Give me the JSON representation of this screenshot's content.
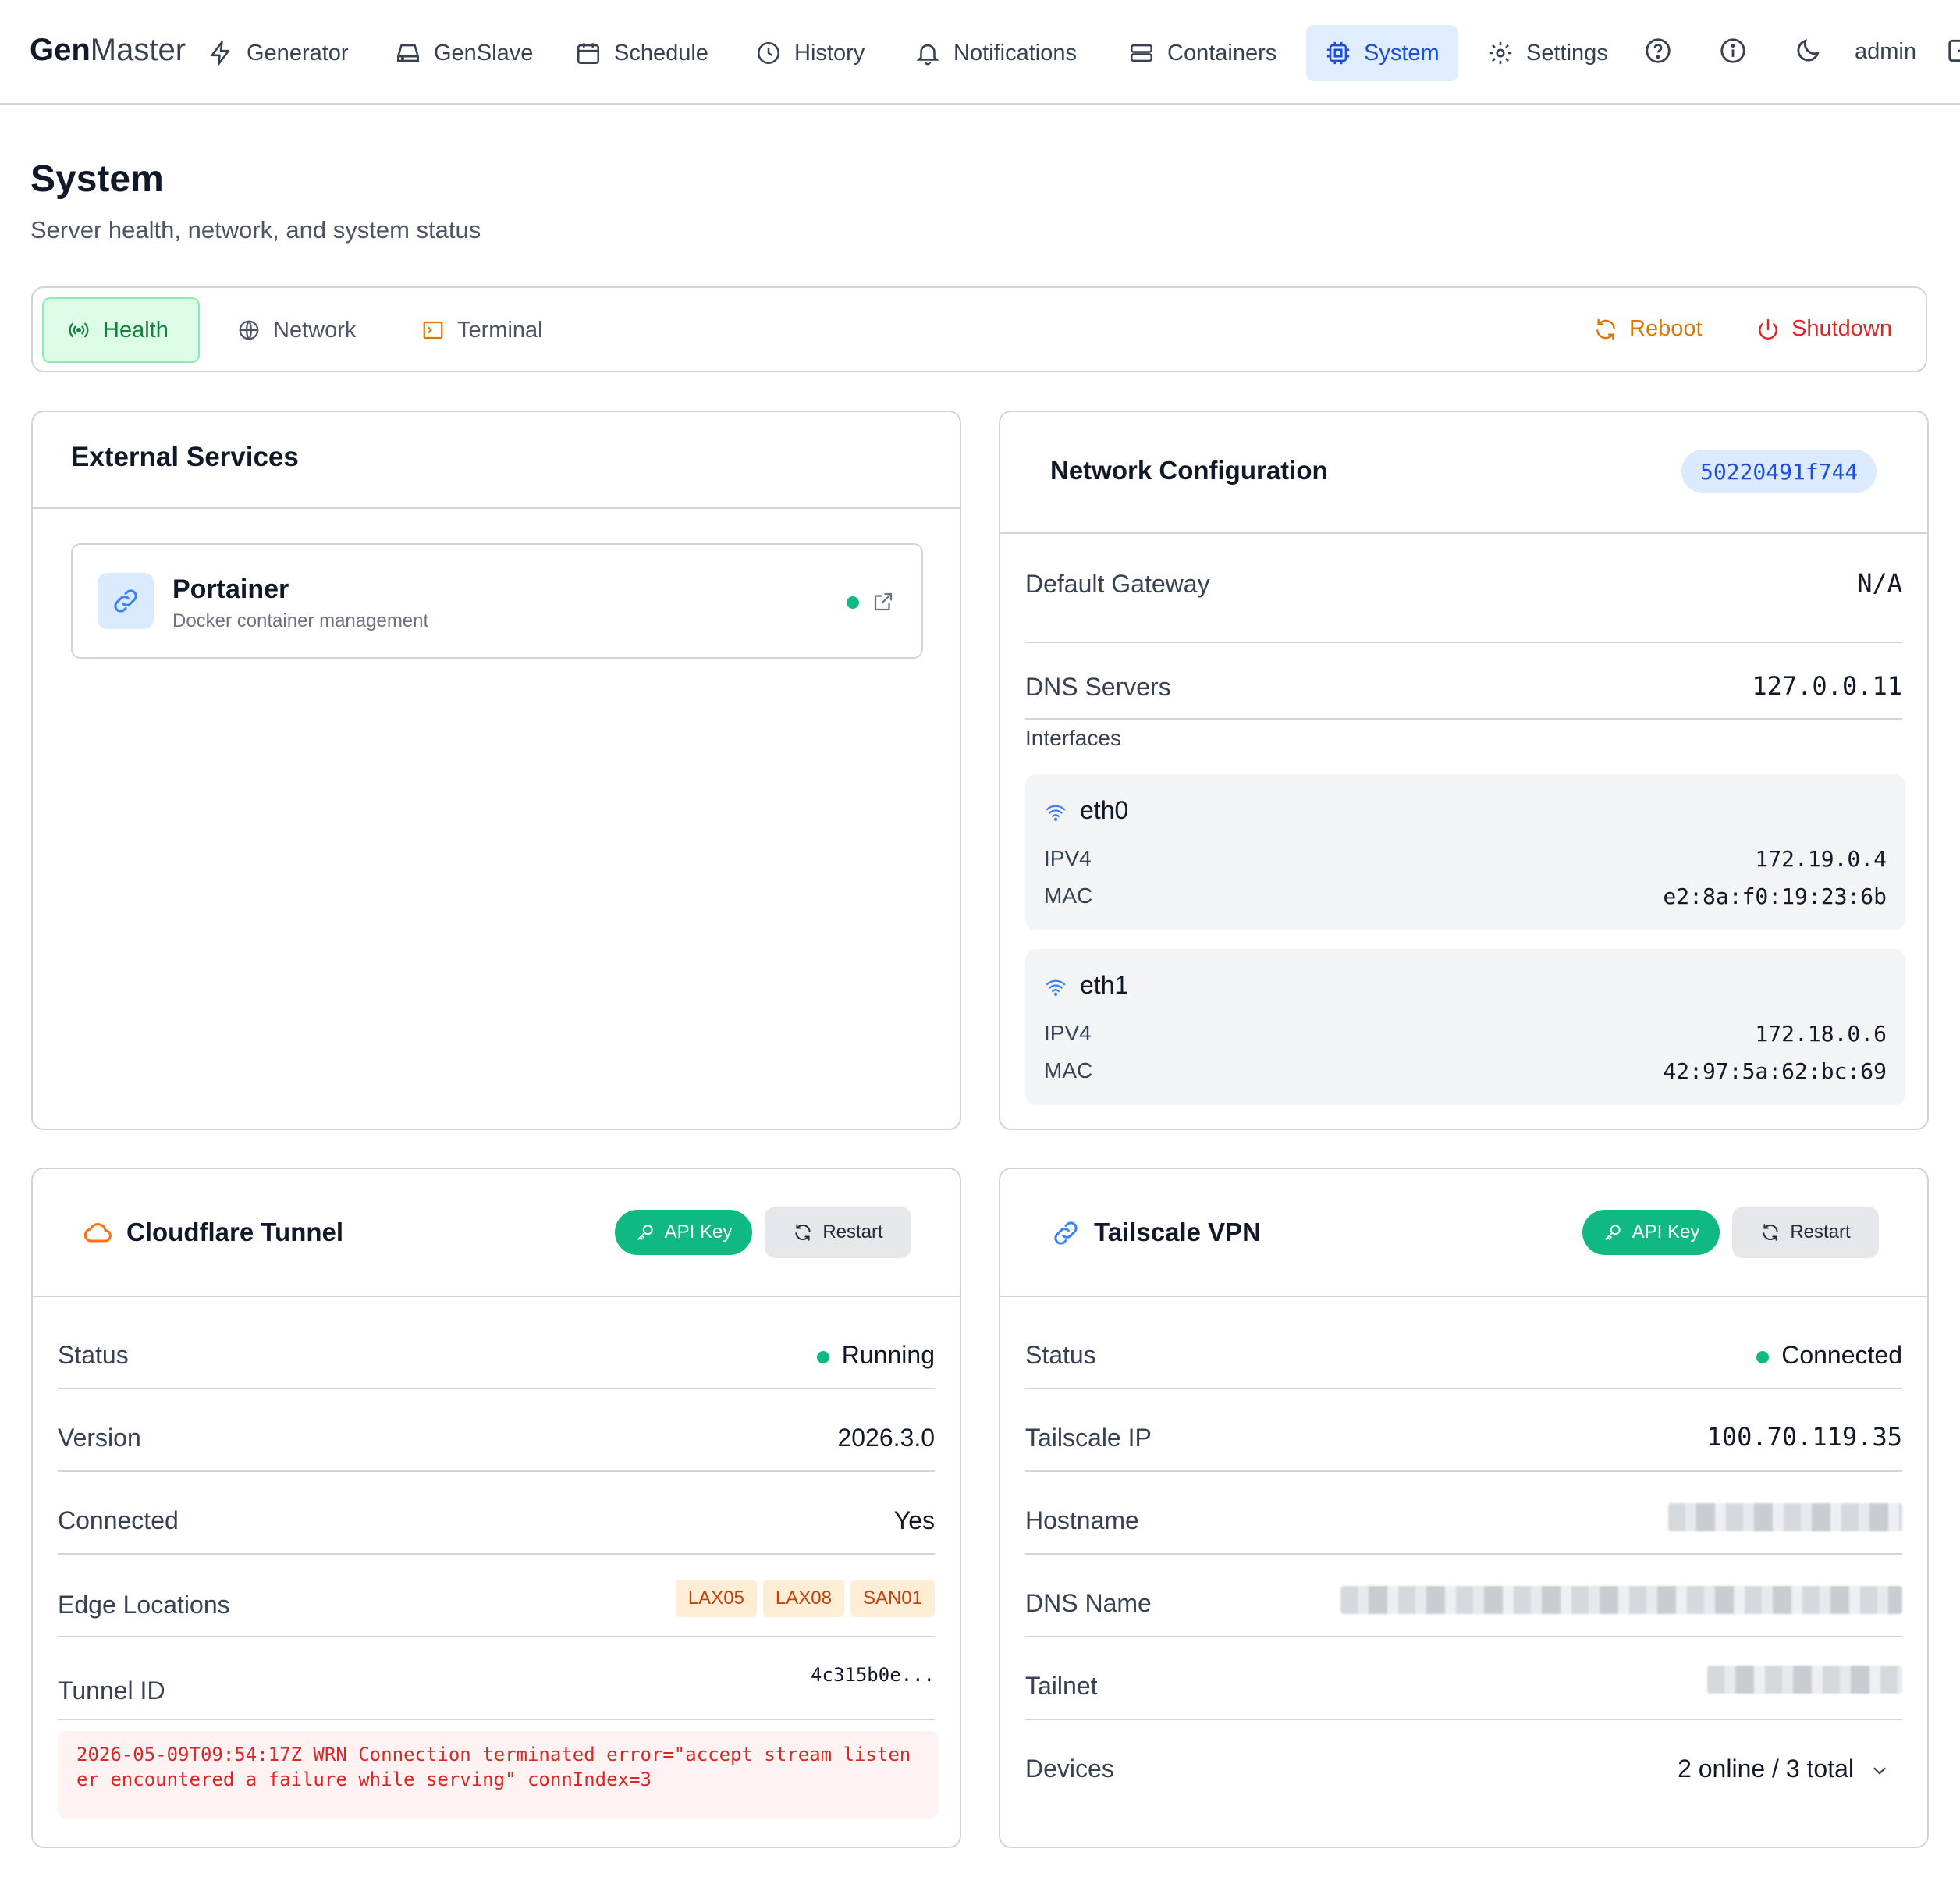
{
  "nav": {
    "brand_bold": "Gen",
    "brand_light": "Master",
    "items": [
      {
        "label": "Generator",
        "icon": "bolt-icon"
      },
      {
        "label": "GenSlave",
        "icon": "hard-drive-icon"
      },
      {
        "label": "Schedule",
        "icon": "calendar-icon"
      },
      {
        "label": "History",
        "icon": "clock-icon"
      },
      {
        "label": "Notifications",
        "icon": "bell-icon"
      },
      {
        "label": "Containers",
        "icon": "server-icon"
      },
      {
        "label": "System",
        "icon": "cpu-icon"
      },
      {
        "label": "Settings",
        "icon": "gear-icon"
      }
    ],
    "active": "System",
    "user": "admin"
  },
  "header": {
    "title": "System",
    "subtitle": "Server health, network, and system status"
  },
  "tabs": {
    "items": [
      {
        "label": "Health",
        "icon": "radio-signal-icon"
      },
      {
        "label": "Network",
        "icon": "globe-icon"
      },
      {
        "label": "Terminal",
        "icon": "terminal-icon"
      }
    ],
    "active": "Health",
    "reboot_label": "Reboot",
    "shutdown_label": "Shutdown"
  },
  "external_services": {
    "title": "External Services",
    "services": [
      {
        "name": "Portainer",
        "description": "Docker container management",
        "status": "online"
      }
    ]
  },
  "network_config": {
    "title": "Network Configuration",
    "host_id": "50220491f744",
    "default_gateway_label": "Default Gateway",
    "default_gateway": "N/A",
    "dns_label": "DNS Servers",
    "dns": "127.0.0.11",
    "interfaces_label": "Interfaces",
    "interfaces": [
      {
        "name": "eth0",
        "ipv4_label": "IPV4",
        "ipv4": "172.19.0.4",
        "mac_label": "MAC",
        "mac": "e2:8a:f0:19:23:6b"
      },
      {
        "name": "eth1",
        "ipv4_label": "IPV4",
        "ipv4": "172.18.0.6",
        "mac_label": "MAC",
        "mac": "42:97:5a:62:bc:69"
      }
    ]
  },
  "cloudflare": {
    "title": "Cloudflare Tunnel",
    "api_key_label": "API Key",
    "restart_label": "Restart",
    "status_label": "Status",
    "status": "Running",
    "version_label": "Version",
    "version": "2026.3.0",
    "connected_label": "Connected",
    "connected": "Yes",
    "edge_label": "Edge Locations",
    "edge_locations": [
      "LAX05",
      "LAX08",
      "SAN01"
    ],
    "tunnel_id_label": "Tunnel ID",
    "tunnel_id": "4c315b0e...",
    "error": "2026-05-09T09:54:17Z WRN Connection terminated error=\"accept stream listener encountered a failure while serving\" connIndex=3"
  },
  "tailscale": {
    "title": "Tailscale VPN",
    "api_key_label": "API Key",
    "restart_label": "Restart",
    "status_label": "Status",
    "status": "Connected",
    "ip_label": "Tailscale IP",
    "ip": "100.70.119.35",
    "hostname_label": "Hostname",
    "dns_name_label": "DNS Name",
    "tailnet_label": "Tailnet",
    "devices_label": "Devices",
    "devices": "2 online / 3 total"
  },
  "colors": {
    "accent_blue": "#1d4ed8",
    "success_green": "#10b981",
    "reboot_orange": "#d97706",
    "shutdown_red": "#dc2626"
  }
}
